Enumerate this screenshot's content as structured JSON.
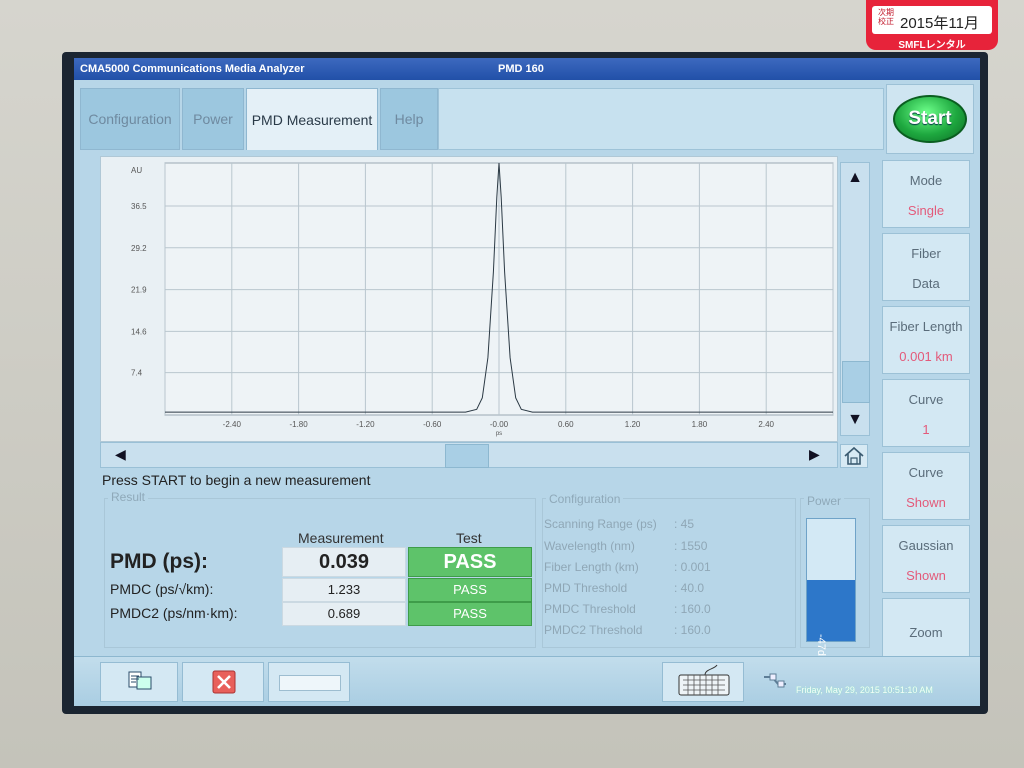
{
  "window": {
    "app_title": "CMA5000 Communications Media Analyzer",
    "module": "PMD 160"
  },
  "tabs": [
    {
      "label": "Configuration",
      "active": false
    },
    {
      "label": "Power",
      "active": false
    },
    {
      "label": "PMD Measurement",
      "active": true
    },
    {
      "label": "Help",
      "active": false
    }
  ],
  "start_button": {
    "label": "Start"
  },
  "side_buttons": [
    {
      "line1": "Mode",
      "line2": "Single"
    },
    {
      "line1": "Fiber",
      "line2": "Data"
    },
    {
      "line1": "Fiber Length",
      "line2": "0.001 km"
    },
    {
      "line1": "Curve",
      "line2": "1"
    },
    {
      "line1": "Curve",
      "line2": "Shown"
    },
    {
      "line1": "Gaussian",
      "line2": "Shown"
    },
    {
      "line1": "Zoom",
      "line2": ""
    }
  ],
  "chart_data": {
    "type": "line",
    "ylabel": "AU",
    "xlabel": "ps",
    "yticks": [
      7.4,
      14.6,
      21.9,
      29.2,
      36.5
    ],
    "ytick_labels": [
      "7.4",
      "14.6",
      "21.9",
      "29.2",
      "36.5"
    ],
    "xticks": [
      -2.4,
      -1.8,
      -1.2,
      -0.6,
      0.0,
      0.6,
      1.2,
      1.8,
      2.4
    ],
    "xtick_labels": [
      "-2.40",
      "-1.80",
      "-1.20",
      "-0.60",
      "-0.00",
      "0.60",
      "1.20",
      "1.80",
      "2.40"
    ],
    "xlim": [
      -3.0,
      3.0
    ],
    "ylim": [
      0,
      44
    ],
    "grid": true,
    "series": [
      {
        "x": [
          -3.0,
          -0.3,
          -0.2,
          -0.15,
          -0.1,
          -0.05,
          -0.02,
          0.0,
          0.02,
          0.05,
          0.1,
          0.15,
          0.2,
          0.3,
          3.0
        ],
        "y": [
          0.5,
          0.5,
          1.0,
          3.0,
          10.0,
          25.0,
          38.0,
          44.0,
          38.0,
          25.0,
          10.0,
          3.0,
          1.0,
          0.5,
          0.5
        ]
      }
    ]
  },
  "status": {
    "message": "Press START to begin a new measurement"
  },
  "result": {
    "legend": "Result",
    "col_measurement": "Measurement",
    "col_test": "Test",
    "rows": [
      {
        "label": "PMD (ps):",
        "value": "0.039",
        "test": "PASS"
      },
      {
        "label": "PMDC (ps/√km):",
        "value": "1.233",
        "test": "PASS"
      },
      {
        "label": "PMDC2 (ps/nm·km):",
        "value": "0.689",
        "test": "PASS"
      }
    ]
  },
  "configuration": {
    "legend": "Configuration",
    "items": [
      {
        "label": "Scanning Range (ps)",
        "value": ": 45"
      },
      {
        "label": "Wavelength (nm)",
        "value": ": 1550"
      },
      {
        "label": "Fiber Length (km)",
        "value": ": 0.001"
      },
      {
        "label": "PMD Threshold",
        "value": ": 40.0"
      },
      {
        "label": "PMDC Threshold",
        "value": ": 160.0"
      },
      {
        "label": "PMDC2 Threshold",
        "value": ": 160.0"
      }
    ]
  },
  "power": {
    "legend": "Power",
    "value": "-47dB",
    "fill_fraction": 0.5
  },
  "taskbar": {
    "datetime": "Friday, May 29, 2015 10:51:10 AM"
  },
  "sticker": {
    "kanji_top": "次期校正",
    "date": "2015年11月",
    "brand": "SMFLレンタル"
  },
  "colors": {
    "titlebar": "#2150a8",
    "pass": "#5ec36a",
    "start": "#1ea83f",
    "power_fill": "#2d77c9"
  }
}
